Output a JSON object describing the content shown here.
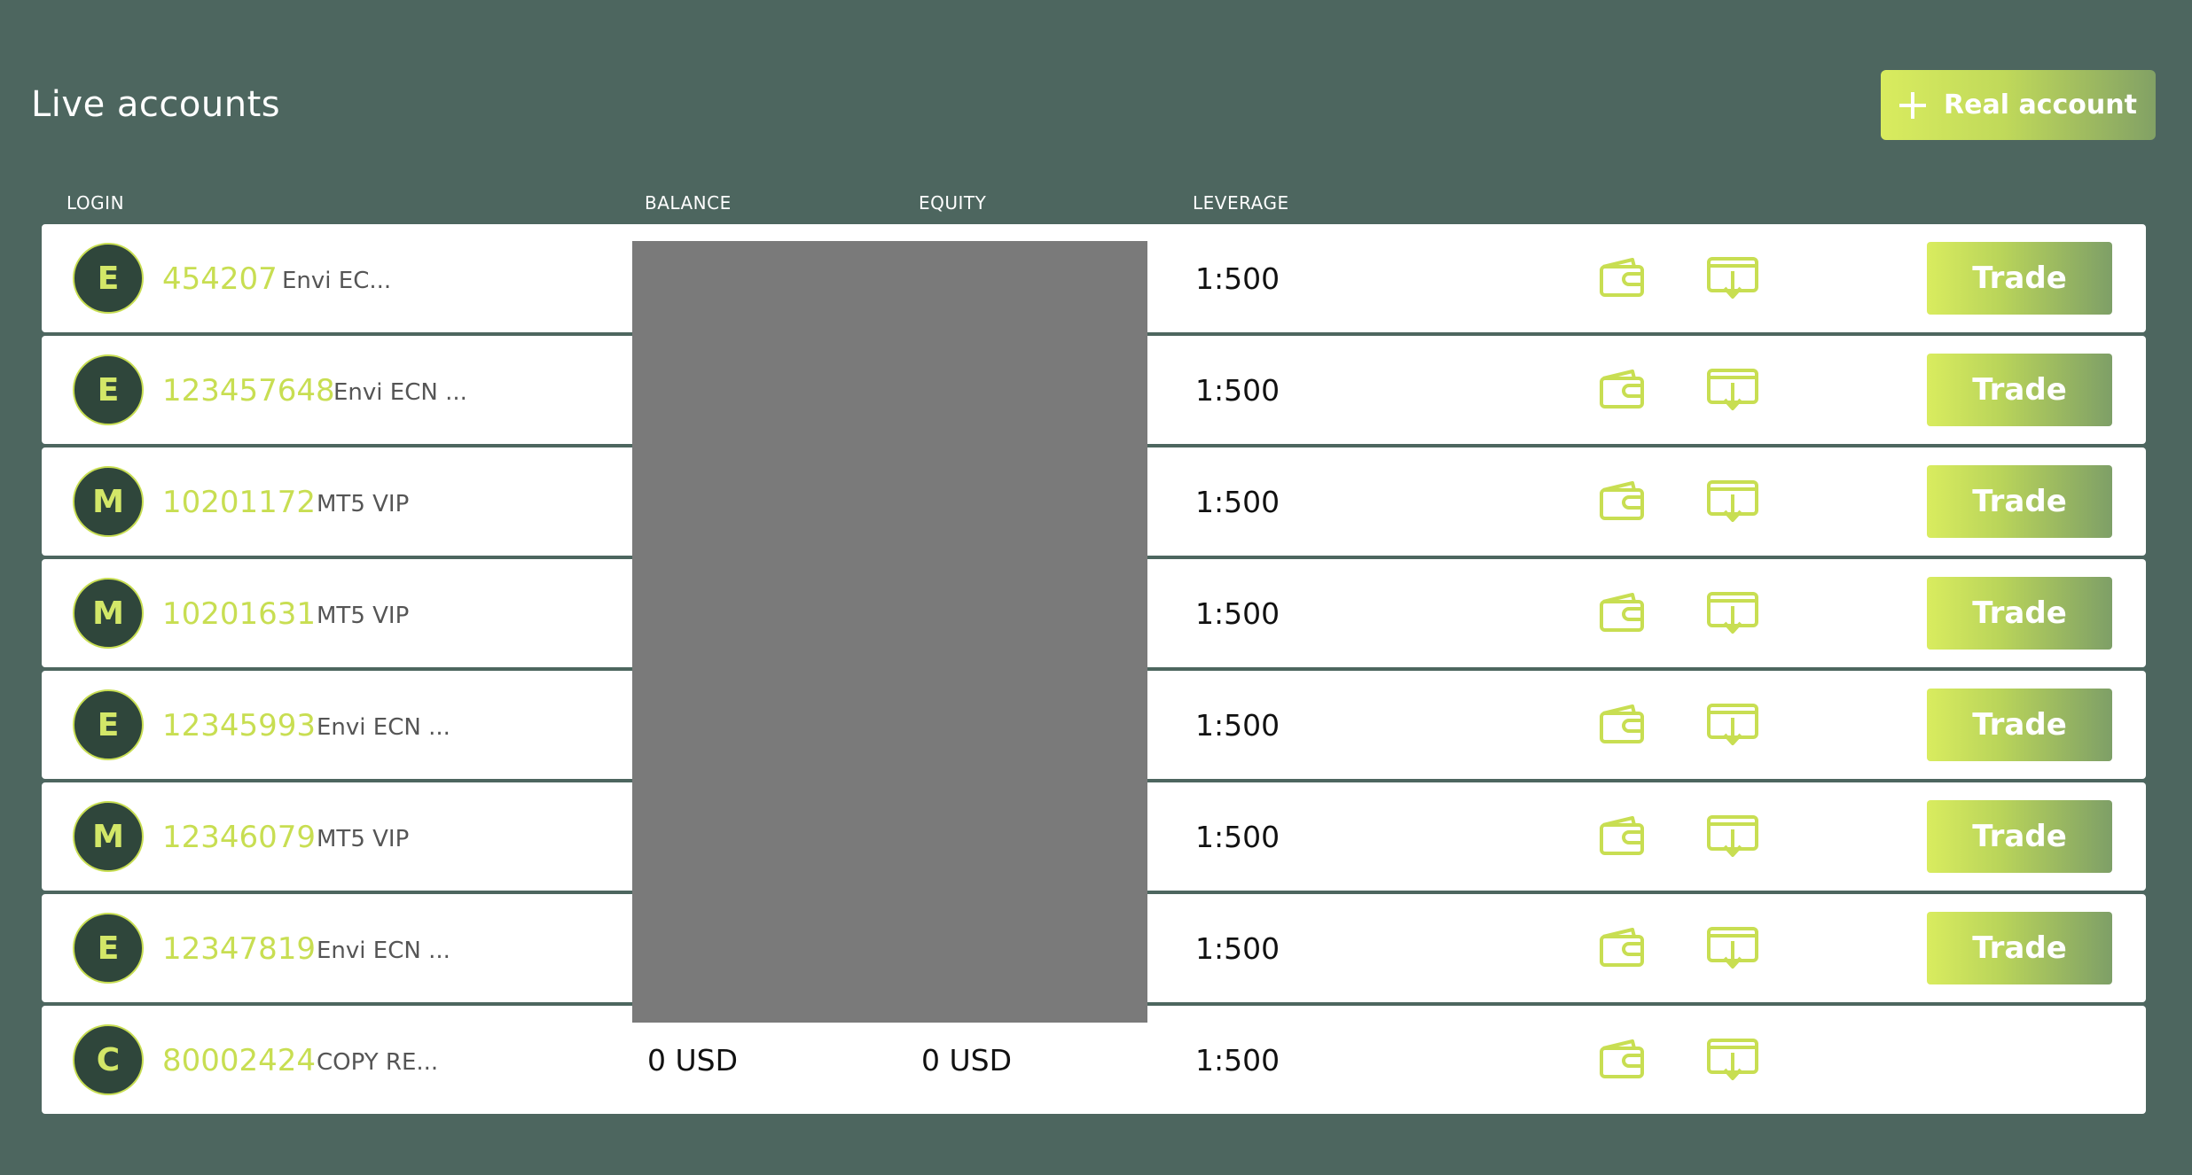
{
  "page": {
    "title": "Live accounts"
  },
  "actions": {
    "new_account_label": "Real account"
  },
  "columns": {
    "login": "LOGIN",
    "balance": "BALANCE",
    "equity": "EQUITY",
    "leverage": "LEVERAGE"
  },
  "accounts": [
    {
      "initial": "E",
      "login": "454207",
      "type": "Envi EC...",
      "balance": "",
      "equity": "",
      "leverage": "1:500",
      "trade_label": "Trade"
    },
    {
      "initial": "E",
      "login": "123457648",
      "type": "Envi ECN ...",
      "balance": "",
      "equity": "",
      "leverage": "1:500",
      "trade_label": "Trade"
    },
    {
      "initial": "M",
      "login": "10201172",
      "type": "MT5 VIP",
      "balance": "",
      "equity": "",
      "leverage": "1:500",
      "trade_label": "Trade"
    },
    {
      "initial": "M",
      "login": "10201631",
      "type": "MT5 VIP",
      "balance": "",
      "equity": "",
      "leverage": "1:500",
      "trade_label": "Trade"
    },
    {
      "initial": "E",
      "login": "12345993",
      "type": "Envi ECN ...",
      "balance": "",
      "equity": "",
      "leverage": "1:500",
      "trade_label": "Trade"
    },
    {
      "initial": "M",
      "login": "12346079",
      "type": "MT5 VIP",
      "balance": "",
      "equity": "",
      "leverage": "1:500",
      "trade_label": "Trade"
    },
    {
      "initial": "E",
      "login": "12347819",
      "type": "Envi ECN ...",
      "balance": "",
      "equity": "",
      "leverage": "1:500",
      "trade_label": "Trade"
    },
    {
      "initial": "C",
      "login": "80002424",
      "type": "COPY RE...",
      "balance": "0 USD",
      "equity": "0 USD",
      "leverage": "1:500",
      "trade_label": ""
    }
  ],
  "icons": {
    "wallet": "wallet-icon",
    "download": "download-icon",
    "plus": "plus-icon"
  },
  "colors": {
    "background": "#4d665f",
    "accent": "#c8de52",
    "avatar_bg": "#2f463b",
    "redaction": "#7a7a7a"
  }
}
